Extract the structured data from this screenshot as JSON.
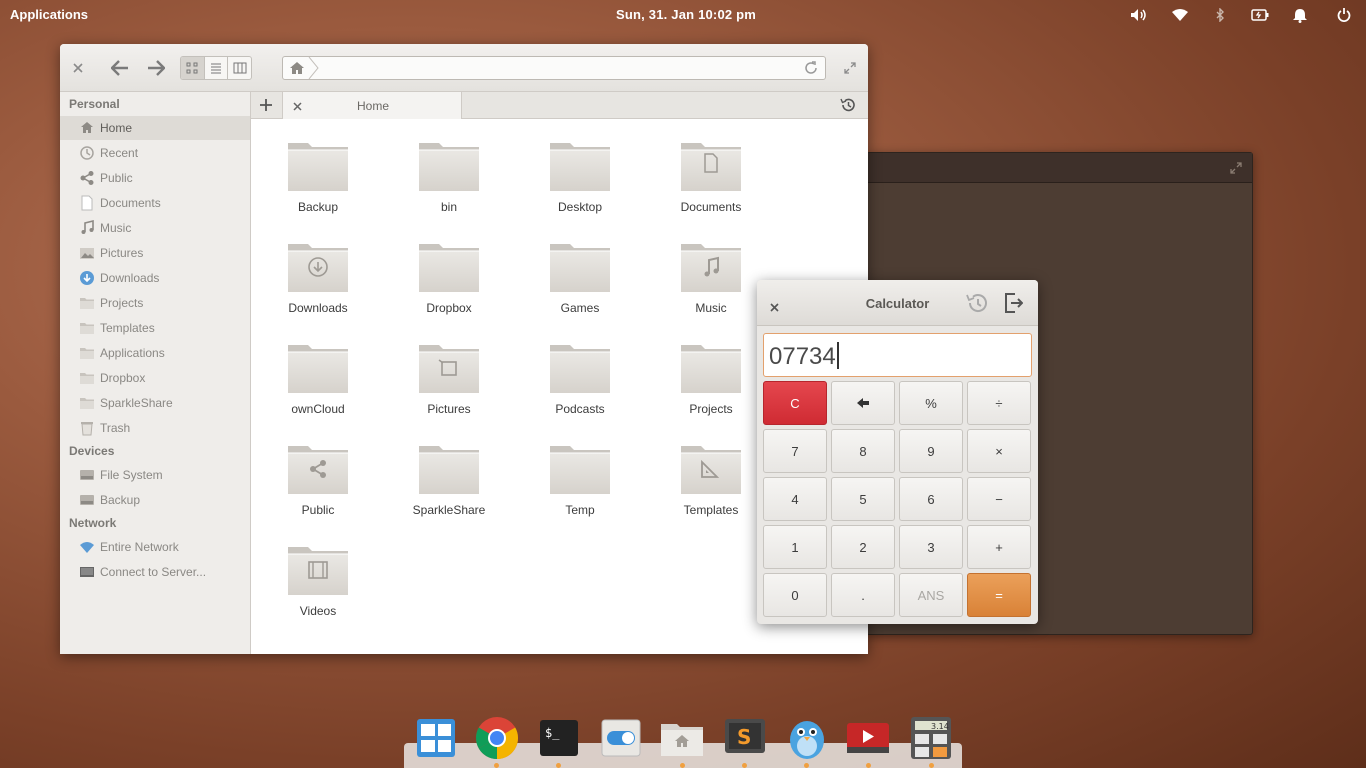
{
  "panel": {
    "applications_label": "Applications",
    "clock": "Sun, 31. Jan  10:02 pm"
  },
  "file_manager": {
    "current_tab": "Home",
    "sidebar": {
      "sections": [
        {
          "heading": "Personal",
          "items": [
            "Home",
            "Recent",
            "Public",
            "Documents",
            "Music",
            "Pictures",
            "Downloads",
            "Projects",
            "Templates",
            "Applications",
            "Dropbox",
            "SparkleShare",
            "Trash"
          ]
        },
        {
          "heading": "Devices",
          "items": [
            "File System",
            "Backup"
          ]
        },
        {
          "heading": "Network",
          "items": [
            "Entire Network",
            "Connect to Server..."
          ]
        }
      ],
      "selected": "Home"
    },
    "folders": [
      {
        "name": "Backup",
        "emblem": "none"
      },
      {
        "name": "bin",
        "emblem": "none"
      },
      {
        "name": "Desktop",
        "emblem": "none"
      },
      {
        "name": "Documents",
        "emblem": "document-icon"
      },
      {
        "name": "Downloads",
        "emblem": "download-icon"
      },
      {
        "name": "Dropbox",
        "emblem": "none"
      },
      {
        "name": "Games",
        "emblem": "none"
      },
      {
        "name": "Music",
        "emblem": "music-note-icon"
      },
      {
        "name": "ownCloud",
        "emblem": "none"
      },
      {
        "name": "Pictures",
        "emblem": "picture-icon"
      },
      {
        "name": "Podcasts",
        "emblem": "none"
      },
      {
        "name": "Projects",
        "emblem": "none"
      },
      {
        "name": "Public",
        "emblem": "share-icon"
      },
      {
        "name": "SparkleShare",
        "emblem": "none"
      },
      {
        "name": "Temp",
        "emblem": "none"
      },
      {
        "name": "Templates",
        "emblem": "template-icon"
      },
      {
        "name": "Videos",
        "emblem": "film-icon"
      }
    ]
  },
  "calculator": {
    "title": "Calculator",
    "display": "07734",
    "keys": [
      [
        "C",
        "←",
        "%",
        "÷"
      ],
      [
        "7",
        "8",
        "9",
        "×"
      ],
      [
        "4",
        "5",
        "6",
        "−"
      ],
      [
        "1",
        "2",
        "3",
        "+"
      ],
      [
        "0",
        ".",
        "ANS",
        "="
      ]
    ]
  },
  "dock": {
    "apps": [
      "multitasking-view-icon",
      "chrome-icon",
      "terminal-icon",
      "switchboard-settings-icon",
      "files-icon",
      "sublime-text-icon",
      "birdie-twitter-icon",
      "youtube-player-icon",
      "calculator-icon"
    ],
    "calculator_icon_text": "3.14"
  },
  "colors": {
    "accent_orange": "#d98237",
    "clear_red": "#cf2b33",
    "panel_text": "#ffffff"
  }
}
